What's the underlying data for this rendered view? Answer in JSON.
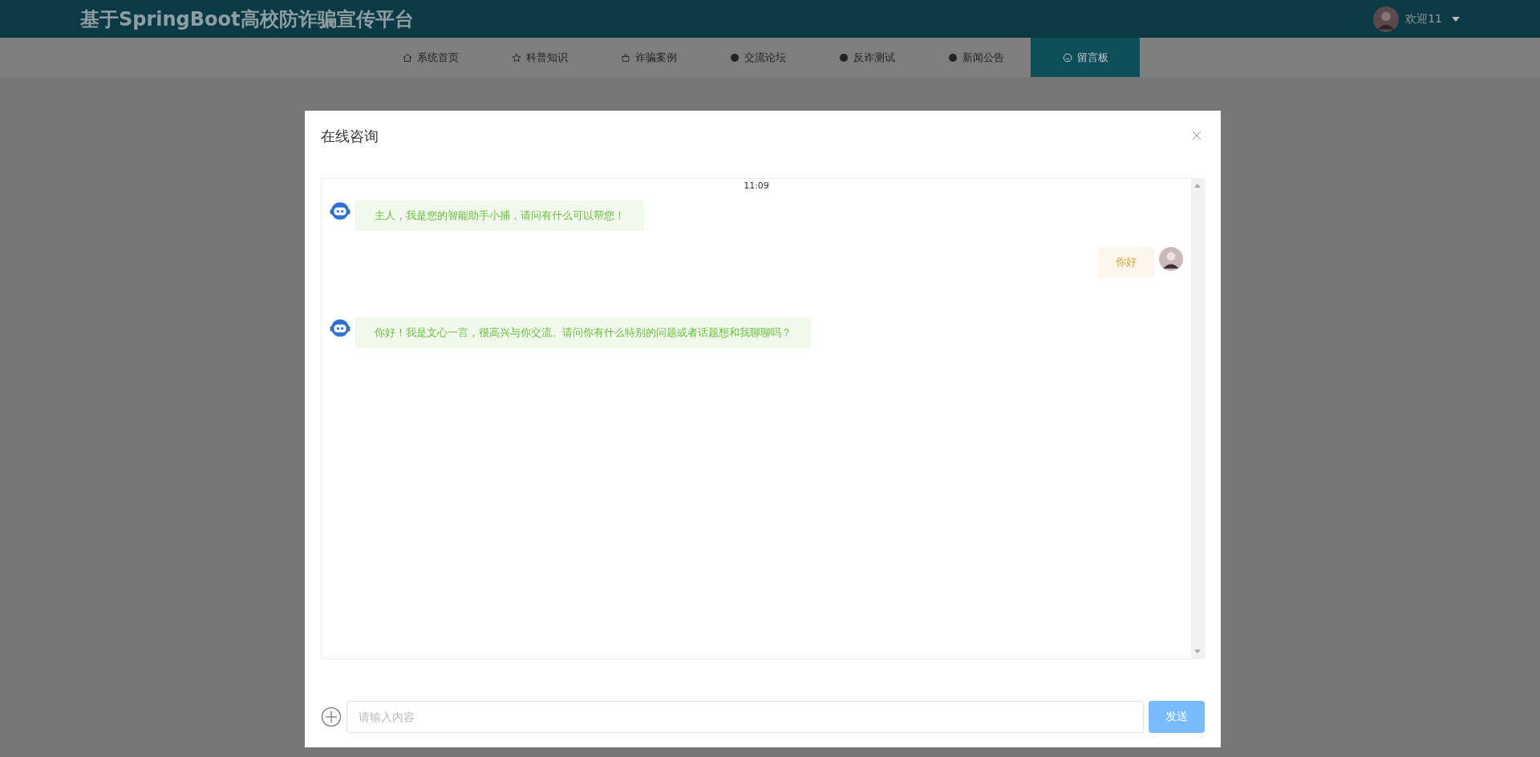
{
  "header": {
    "title": "基于SpringBoot高校防诈骗宣传平台",
    "user": "欢迎11"
  },
  "nav": [
    {
      "label": "系统首页",
      "kind": "home",
      "selected": false
    },
    {
      "label": "科普知识",
      "kind": "star",
      "selected": false
    },
    {
      "label": "诈骗案例",
      "kind": "bag",
      "selected": false
    },
    {
      "label": "交流论坛",
      "kind": "dot",
      "selected": false
    },
    {
      "label": "反诈测试",
      "kind": "dot",
      "selected": false
    },
    {
      "label": "新闻公告",
      "kind": "dot",
      "selected": false
    },
    {
      "label": "留言板",
      "kind": "smile",
      "selected": true
    }
  ],
  "dialog": {
    "title": "在线咨询",
    "time": "11:09",
    "messages": [
      {
        "kind": "bot",
        "text": "主人，我是您的智能助手小捕，请问有什么可以帮您！"
      },
      {
        "kind": "user",
        "text": "你好"
      },
      {
        "kind": "bot",
        "text": "你好！我是文心一言，很高兴与你交流。请问你有什么特别的问题或者话题想和我聊聊吗？"
      }
    ],
    "input": {
      "placeholder": "请输入内容"
    },
    "send": "发送"
  }
}
